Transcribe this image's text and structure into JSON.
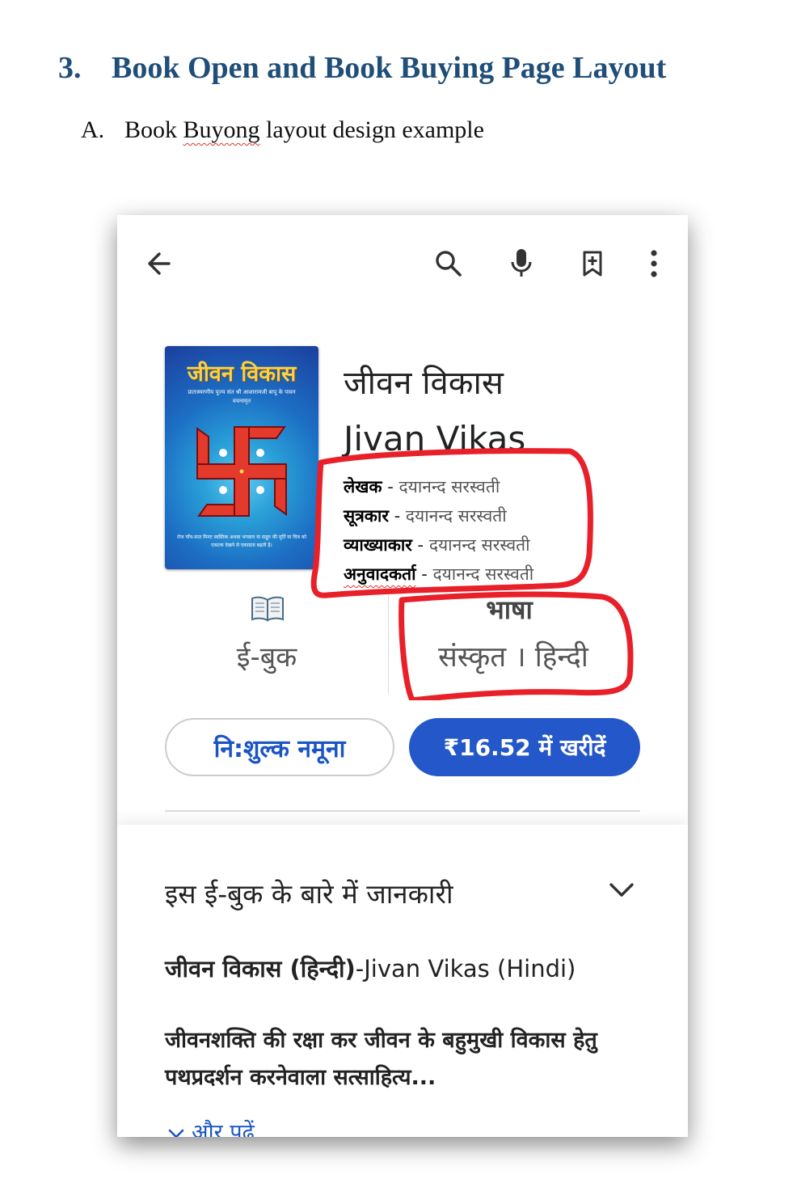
{
  "document": {
    "section_number": "3.",
    "section_title": "Book Open and Book Buying Page Layout",
    "sub_label": "A.",
    "sub_pre": "Book ",
    "sub_misspelled": "Buyong",
    "sub_post": " layout design example"
  },
  "app": {
    "toolbar": {
      "back_icon": "arrow-left-icon",
      "search_icon": "search-icon",
      "mic_icon": "mic-icon",
      "bookmark_icon": "bookmark-add-icon",
      "more_icon": "more-vert-icon"
    },
    "book": {
      "cover_title": "जीवन विकास",
      "cover_subtitle": "प्रातःस्मरणीय पूज्य संत श्री आशारामजी बापू के पावन वचनामृत",
      "cover_footer": "रोज पाँच-सात मिनट स्वस्तिक अथवा भगवान या सद्गुरु की मूर्ति या चित्र को एकटक देखने से एकाग्रता बढ़ती है।",
      "title_hindi": "जीवन विकास",
      "title_english": "Jivan Vikas",
      "credits": [
        {
          "label": "लेखक",
          "sep": " - ",
          "value": "दयानन्द सरस्वती"
        },
        {
          "label": "सूत्रकार",
          "sep": " - ",
          "value": "दयानन्द सरस्वती"
        },
        {
          "label": "व्याख्याकार",
          "sep": " - ",
          "value": "दयानन्द सरस्वती"
        },
        {
          "label": "अनुवादकर्ता",
          "sep": " - ",
          "value": "दयानन्द सरस्वती"
        }
      ],
      "format_icon": "open-book-icon",
      "format_label": "ई-बुक",
      "language_label": "भाषा",
      "language_value": "संस्कृत । हिन्दी"
    },
    "buttons": {
      "free_sample": "नि:शुल्क नमूना",
      "buy": "₹16.52 में खरीदें"
    },
    "about": {
      "title": "इस ई-बुक के बारे में जानकारी",
      "line1_hindi": "जीवन विकास (हिन्दी)",
      "line1_rest": "-Jivan Vikas (Hindi)",
      "description": "जीवनशक्ति की रक्षा कर जीवन के बहुमुखी विकास हेतु पथप्रदर्शन करनेवाला सत्साहित्य...",
      "read_more": "और पढ़ें"
    }
  },
  "colors": {
    "heading": "#1f4e79",
    "buy_button": "#2457c9",
    "link": "#1a55c4",
    "annotation": "#e8202a"
  }
}
